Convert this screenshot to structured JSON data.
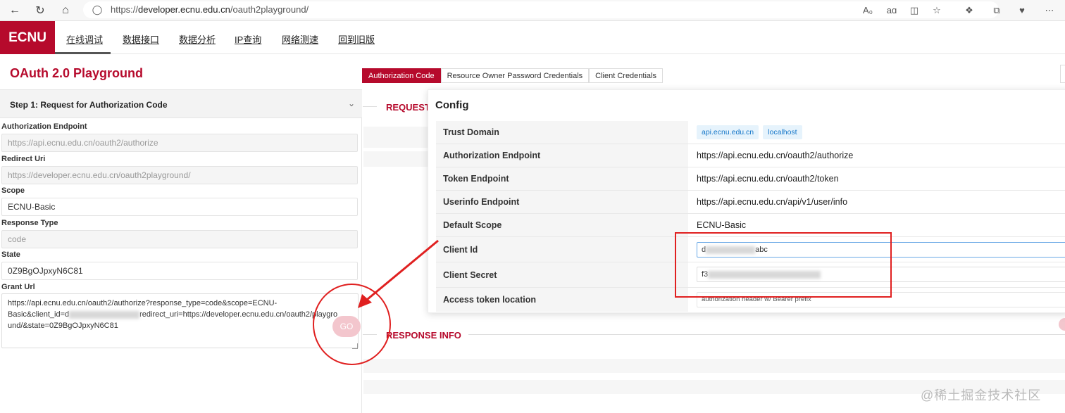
{
  "browser": {
    "url_prefix": "https://",
    "url_host": "developer.ecnu.edu.cn",
    "url_path": "/oauth2playground/"
  },
  "nav": {
    "logo": "ECNU",
    "items": [
      "在线调试",
      "数据接口",
      "数据分析",
      "IP查询",
      "网络测速",
      "回到旧版"
    ]
  },
  "page_title": "OAuth 2.0 Playground",
  "tabs": [
    "Authorization Code",
    "Resource Owner Password Credentials",
    "Client Credentials"
  ],
  "step": {
    "title": "Step 1: Request for Authorization Code"
  },
  "fields": {
    "auth_endpoint": {
      "label": "Authorization Endpoint",
      "value": "https://api.ecnu.edu.cn/oauth2/authorize"
    },
    "redirect_uri": {
      "label": "Redirect Uri",
      "value": "https://developer.ecnu.edu.cn/oauth2playground/"
    },
    "scope": {
      "label": "Scope",
      "value": "ECNU-Basic"
    },
    "response_type": {
      "label": "Response Type",
      "value": "code"
    },
    "state": {
      "label": "State",
      "value": "0Z9BgOJpxyN6C81"
    },
    "grant_url": {
      "label": "Grant Url",
      "part1": "https://api.ecnu.edu.cn/oauth2/authorize?response_type=code&scope=ECNU-",
      "part2": "Basic&client_id=d",
      "part3": "redirect_uri=https://developer.ecnu.edu.cn/oauth2/playgro",
      "part4": "und/&state=0Z9BgOJpxyN6C81"
    },
    "go_label": "GO"
  },
  "right": {
    "request_header": "REQUEST",
    "response_header": "RESPONSE INFO"
  },
  "config": {
    "title": "Config",
    "trust_domain": {
      "label": "Trust Domain",
      "tags": [
        "api.ecnu.edu.cn",
        "localhost"
      ]
    },
    "auth_endpoint": {
      "label": "Authorization Endpoint",
      "value": "https://api.ecnu.edu.cn/oauth2/authorize"
    },
    "token_endpoint": {
      "label": "Token Endpoint",
      "value": "https://api.ecnu.edu.cn/oauth2/token"
    },
    "userinfo_endpoint": {
      "label": "Userinfo Endpoint",
      "value": "https://api.ecnu.edu.cn/api/v1/user/info"
    },
    "default_scope": {
      "label": "Default Scope",
      "value": "ECNU-Basic"
    },
    "client_id": {
      "label": "Client Id",
      "prefix": "d",
      "suffix": "abc"
    },
    "client_secret": {
      "label": "Client Secret",
      "prefix": "f3"
    },
    "access_token_location": {
      "label": "Access token location",
      "value": "authorization header w/ Bearer prefix"
    }
  },
  "watermark": "@稀土掘金技术社区",
  "colors": {
    "brand": "#b60a2c",
    "annotation": "#e02020",
    "tag": "#1677c9"
  }
}
